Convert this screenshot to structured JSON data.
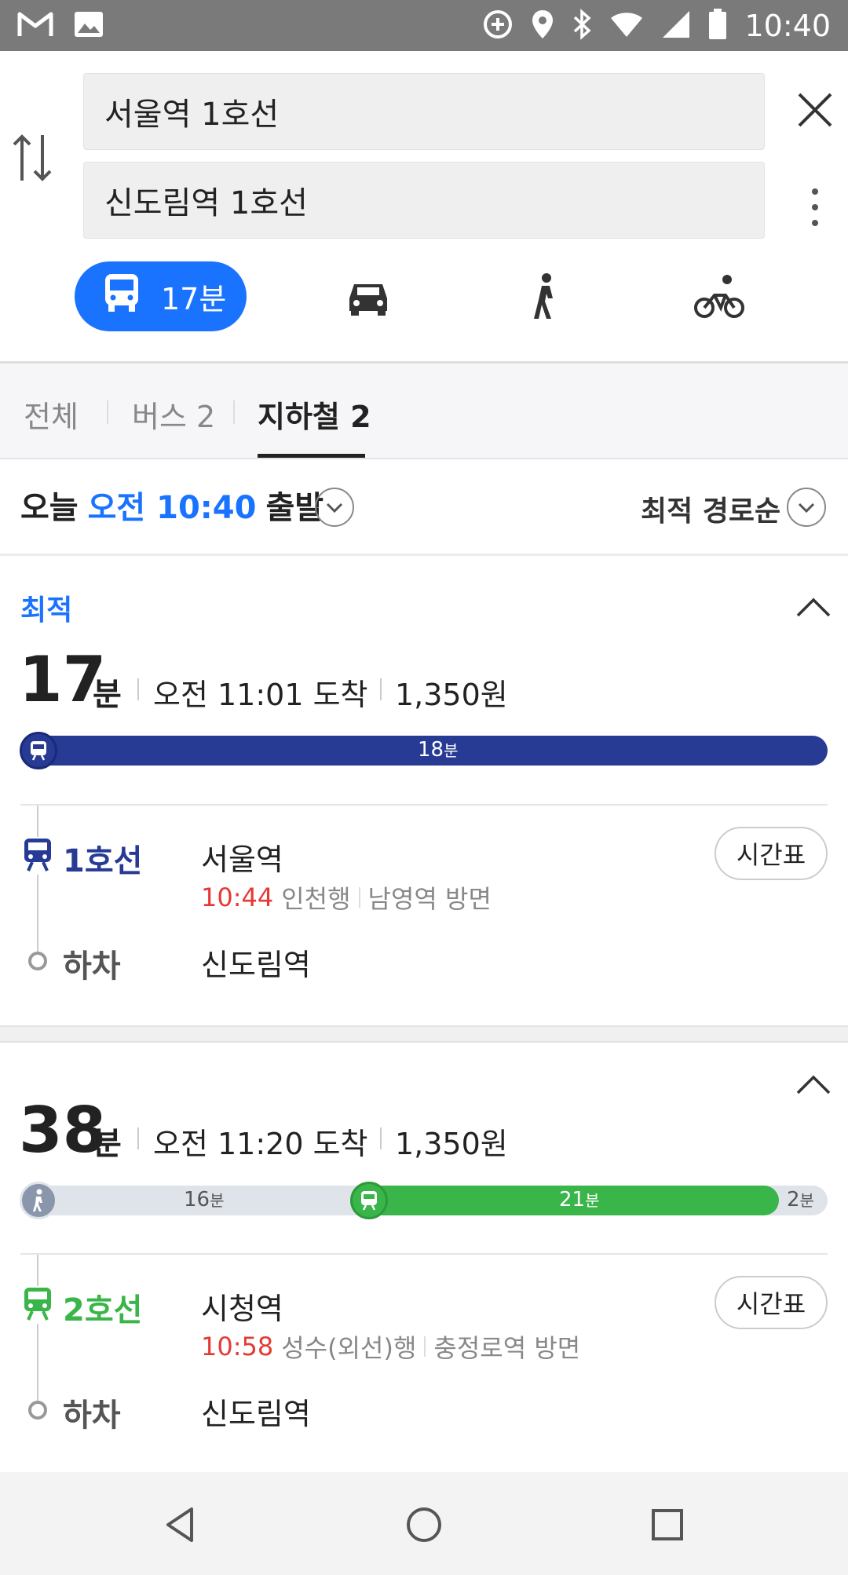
{
  "status_bar": {
    "time": "10:40",
    "left_icons": [
      "gmail-icon",
      "image-icon"
    ],
    "right_icons": [
      "data-saver-icon",
      "location-icon",
      "bluetooth-icon",
      "wifi-icon",
      "signal-icon",
      "battery-icon"
    ]
  },
  "search": {
    "origin": "서울역 1호선",
    "destination": "신도림역 1호선"
  },
  "modes": {
    "transit_time": "17분",
    "items": [
      "bus-icon",
      "car-icon",
      "walk-icon",
      "bicycle-icon"
    ]
  },
  "filter_tabs": [
    {
      "label": "전체"
    },
    {
      "label": "버스 2"
    },
    {
      "label": "지하철 2",
      "active": true
    }
  ],
  "departure": {
    "prefix": "오늘",
    "time_label": "오전 10:40",
    "suffix": "출발",
    "sort_label": "최적 경로순"
  },
  "routes": [
    {
      "badge": "최적",
      "duration": "17",
      "duration_unit": "분",
      "arrival": "오전 11:01 도착",
      "fare": "1,350원",
      "bar": [
        {
          "mode": "subway",
          "minutes": "18",
          "unit": "분",
          "color": "#273a94"
        }
      ],
      "line": {
        "name": "1호선",
        "color": "#273a94"
      },
      "board_station": "서울역",
      "depart_time": "10:44",
      "direction": "인천행",
      "next_station": "남영역 방면",
      "timetable_label": "시간표",
      "alight_label": "하차",
      "alight_station": "신도림역"
    },
    {
      "duration": "38",
      "duration_unit": "분",
      "arrival": "오전 11:20 도착",
      "fare": "1,350원",
      "bar": [
        {
          "mode": "walk",
          "minutes": "16",
          "unit": "분",
          "color": "#dfe3ea"
        },
        {
          "mode": "subway",
          "minutes": "21",
          "unit": "분",
          "color": "#3ab54a"
        },
        {
          "mode": "walk",
          "minutes": "2",
          "unit": "분",
          "color": "#dfe3ea"
        }
      ],
      "line": {
        "name": "2호선",
        "color": "#3ab54a"
      },
      "board_station": "시청역",
      "depart_time": "10:58",
      "direction": "성수(외선)행",
      "next_station": "충정로역 방면",
      "timetable_label": "시간표",
      "alight_label": "하차",
      "alight_station": "신도림역"
    }
  ],
  "nav_bar": [
    "back-icon",
    "home-icon",
    "recents-icon"
  ]
}
